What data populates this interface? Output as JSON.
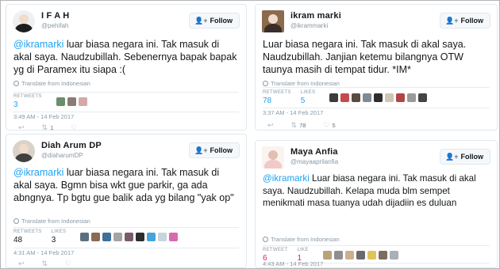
{
  "follow_label": "Follow",
  "translate_label": "Translate from Indonesian",
  "labels": {
    "retweets": "RETWEETS",
    "likes": "LIKES",
    "retweet": "RETWEET",
    "like": "LIKE"
  },
  "tweets": [
    {
      "display_name": "I F A H",
      "handle": "@pehifah",
      "text_mention": "@ikramarki",
      "text_rest": " luar biasa negara ini. Tak masuk di akal saya. Naudzubillah. Sebenernya bapak bapak yg di Paramex itu siapa :(",
      "retweets": "3",
      "timestamp": "3:49 AM - 14 Feb 2017",
      "retweet_count": "1"
    },
    {
      "display_name": "ikram marki",
      "handle": "@ikrammarki",
      "text": "Luar biasa negara ini. Tak masuk di akal saya. Naudzubillah. Janjian ketemu bilangnya OTW taunya masih di tempat tidur. *IM*",
      "retweets": "78",
      "likes": "5",
      "timestamp": "3:37 AM - 14 Feb 2017",
      "retweet_count": "78",
      "like_count": "5"
    },
    {
      "display_name": "Diah Arum DP",
      "handle": "@diaharumDP",
      "text_mention": "@ikramarki",
      "text_rest": " luar biasa negara ini. Tak masuk di akal saya. Bgmn bisa wkt gue parkir, ga ada abngnya. Tp bgtu gue balik ada yg bilang \"yak op\"",
      "retweets": "48",
      "likes": "3",
      "timestamp": "4:31 AM - 14 Feb 2017"
    },
    {
      "display_name": "Maya Anfia",
      "handle": "@mayaaprilanfia",
      "text_mention": "@ikramarki",
      "text_rest": " Luar biasa negara ini. Tak masuk di akal saya. Naudzubillah. Kelapa muda blm sempet menikmati masa tuanya udah dijadiin es duluan",
      "retweets": "6",
      "likes": "1",
      "timestamp": "4:43 AM - 14 Feb 2017"
    }
  ]
}
